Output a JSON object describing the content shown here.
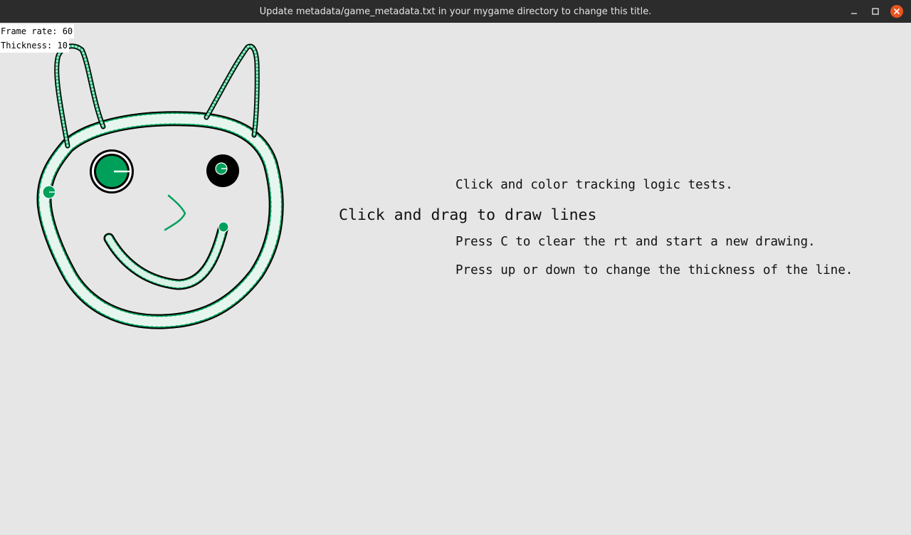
{
  "window": {
    "title": "Update metadata/game_metadata.txt in your mygame directory to change this title.",
    "minimize_icon": "minimize-icon",
    "maximize_icon": "maximize-icon",
    "close_icon": "close-icon",
    "close_color": "#e95420"
  },
  "hud": {
    "frame_rate": "Frame rate: 60",
    "thickness": "Thickness: 10"
  },
  "messages": {
    "line1": "Click and color tracking logic tests.",
    "line2": "Click and drag to draw lines",
    "line3": "Press C to clear the rt and start a new drawing.",
    "line4": "Press up or down to change the thickness of the line."
  },
  "drawing": {
    "stroke_color": "#00a05a",
    "outline_color": "#000000",
    "background": "#e6e6e6"
  }
}
